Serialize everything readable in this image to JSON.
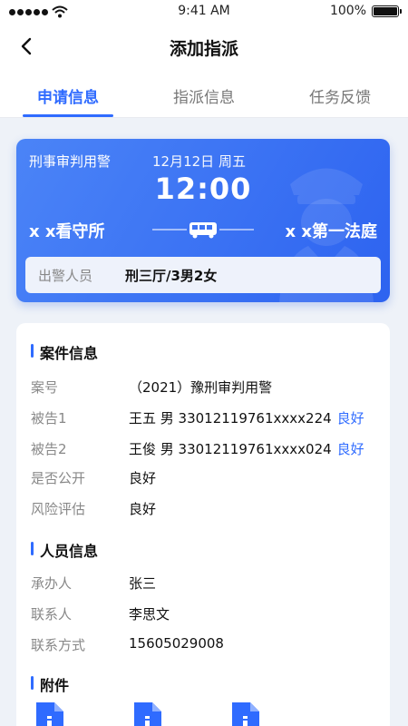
{
  "status_bar": {
    "time": "9:41 AM",
    "battery": "100%"
  },
  "nav": {
    "title": "添加指派"
  },
  "tabs": [
    {
      "label": "申请信息"
    },
    {
      "label": "指派信息"
    },
    {
      "label": "任务反馈"
    }
  ],
  "card": {
    "type": "刑事审判用警",
    "date": "12月12日 周五",
    "time": "12:00",
    "from": "x x看守所",
    "to": "x x第一法庭",
    "officers_label": "出警人员",
    "officers_value": "刑三厅/3男2女"
  },
  "case_section": {
    "title": "案件信息",
    "rows": [
      {
        "label": "案号",
        "value": "（2021）豫刑审判用警",
        "tag": ""
      },
      {
        "label": "被告1",
        "value": "王五 男 33012119761xxxx224",
        "tag": "良好"
      },
      {
        "label": "被告2",
        "value": "王俊 男 33012119761xxxx024",
        "tag": "良好"
      },
      {
        "label": "是否公开",
        "value": "良好",
        "tag": ""
      },
      {
        "label": "风险评估",
        "value": "良好",
        "tag": ""
      }
    ]
  },
  "people_section": {
    "title": "人员信息",
    "rows": [
      {
        "label": "承办人",
        "value": "张三"
      },
      {
        "label": "联系人",
        "value": "李思文"
      },
      {
        "label": "联系方式",
        "value": "15605029008"
      }
    ]
  },
  "attachments": {
    "title": "附件"
  },
  "colors": {
    "accent": "#2f6bff",
    "card_start": "#4b84f7",
    "card_end": "#2d63f0",
    "page_bg": "#eef2f8"
  }
}
